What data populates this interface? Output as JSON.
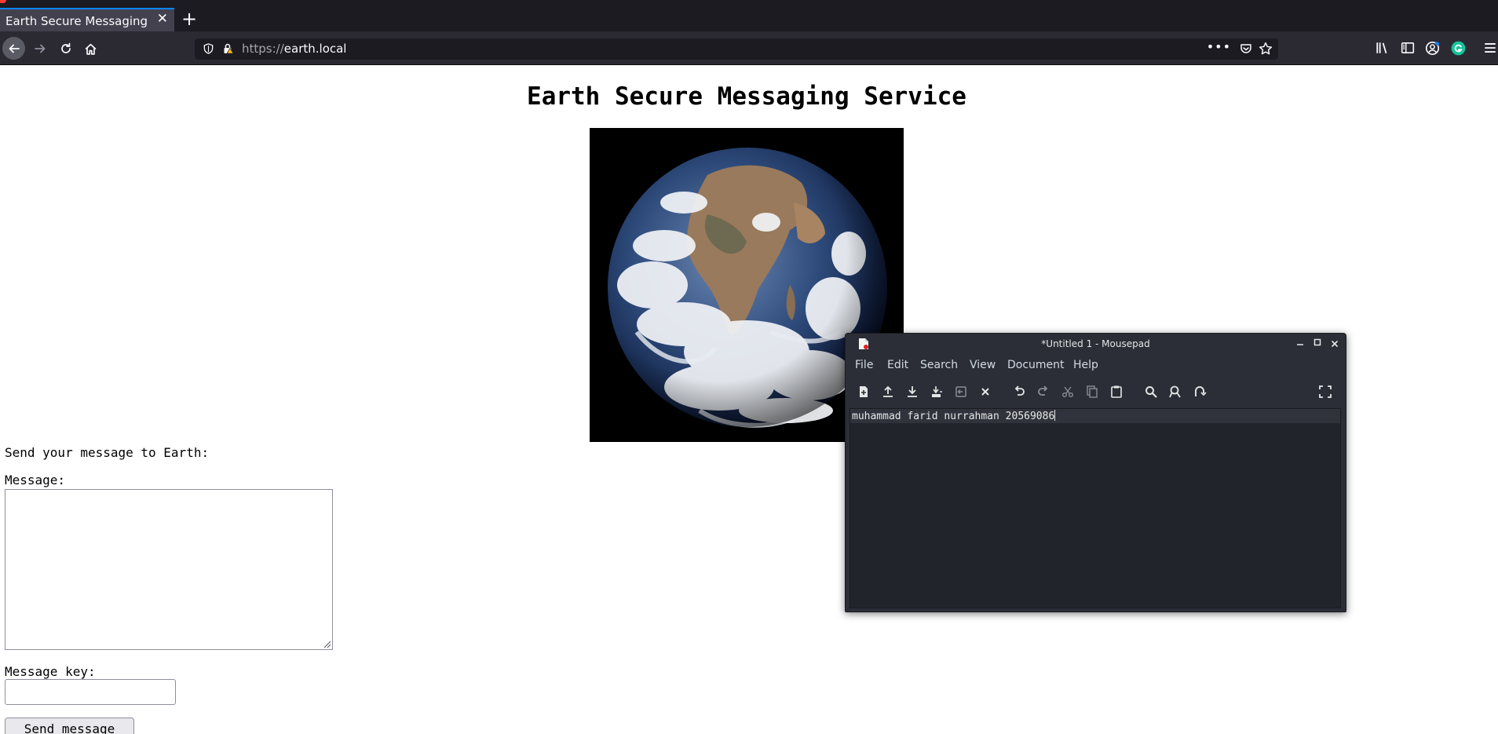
{
  "browser": {
    "tab_title": "Earth Secure Messaging",
    "tab_close": "✕",
    "new_tab": "+",
    "url_prefix": "https://",
    "url_host": "earth.local",
    "url_more": "•••"
  },
  "page": {
    "title": "Earth Secure Messaging Service",
    "earth_image_icon": "earth-photo",
    "prompt": "Send your message to Earth:",
    "message_label": "Message:",
    "message_value": "",
    "key_label": "Message key:",
    "key_value": "",
    "send_button": "Send message"
  },
  "mousepad": {
    "title": "*Untitled 1 - Mousepad",
    "menus": {
      "file": "File",
      "edit": "Edit",
      "search": "Search",
      "view": "View",
      "document": "Document",
      "help": "Help"
    },
    "content": "muhammad farid nurrahman 20569086"
  },
  "colors": {
    "browser_dark": "#1c1b22",
    "toolbar": "#2b2a33",
    "tab_accent": "#0a84ff",
    "mousepad_bg": "#2b2e37",
    "editor_bg": "#22242b",
    "grammarly_green": "#15c39a"
  }
}
